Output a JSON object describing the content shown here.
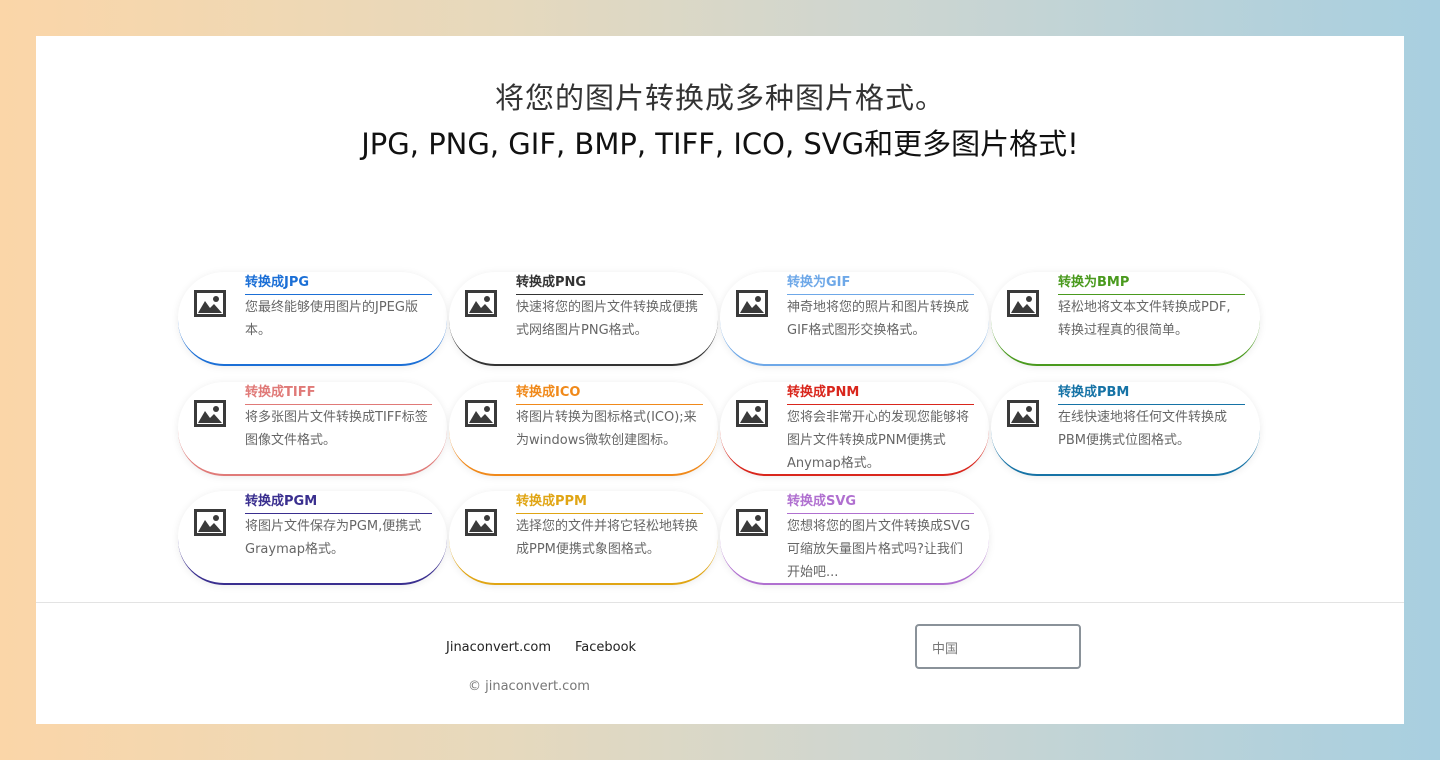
{
  "hero": {
    "line1": "将您的图片转换成多种图片格式。",
    "line2": "JPG, PNG, GIF, BMP, TIFF, ICO, SVG和更多图片格式!"
  },
  "cards": [
    {
      "title": "转换成JPG",
      "desc": "您最终能够使用图片的JPEG版本。",
      "color": "#1b6fd6"
    },
    {
      "title": "转换成PNG",
      "desc": "快速将您的图片文件转换成便携式网络图片PNG格式。",
      "color": "#333333"
    },
    {
      "title": "转换为GIF",
      "desc": "神奇地将您的照片和图片转换成GIF格式图形交换格式。",
      "color": "#6ea8e8"
    },
    {
      "title": "转换为BMP",
      "desc": "轻松地将文本文件转换成PDF, 转换过程真的很简单。",
      "color": "#4a9a1e"
    },
    {
      "title": "转换成TIFF",
      "desc": "将多张图片文件转换成TIFF标签图像文件格式。",
      "color": "#e07a78"
    },
    {
      "title": "转换成ICO",
      "desc": "将图片转换为图标格式(ICO);来为windows微软创建图标。",
      "color": "#f0891a"
    },
    {
      "title": "转换成PNM",
      "desc": "您将会非常开心的发现您能够将图片文件转换成PNM便携式Anymap格式。",
      "color": "#d9261c"
    },
    {
      "title": "转换成PBM",
      "desc": "在线快速地将任何文件转换成PBM便携式位图格式。",
      "color": "#1673a6"
    },
    {
      "title": "转换成PGM",
      "desc": "将图片文件保存为PGM,便携式Graymap格式。",
      "color": "#3a2f8f"
    },
    {
      "title": "转换成PPM",
      "desc": "选择您的文件并将它轻松地转换成PPM便携式象图格式。",
      "color": "#e0a514"
    },
    {
      "title": "转换成SVG",
      "desc": "您想将您的图片文件转换成SVG可缩放矢量图片格式吗?让我们开始吧...",
      "color": "#b070d0"
    }
  ],
  "card_icon": "image-icon",
  "footer": {
    "links": [
      "Jinaconvert.com",
      "Facebook"
    ],
    "copyright": "© jinaconvert.com",
    "region": "中国"
  }
}
